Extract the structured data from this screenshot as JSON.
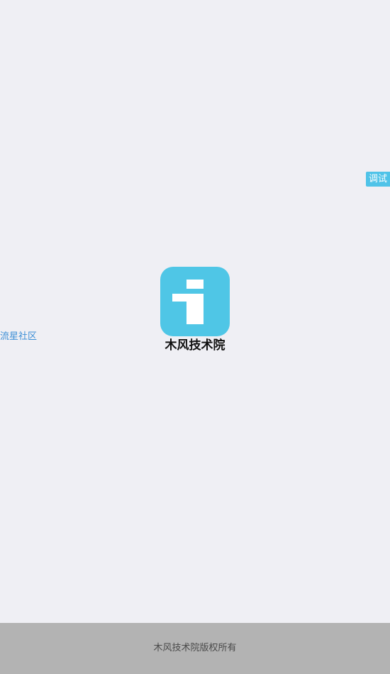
{
  "debug_badge": {
    "label": "调试"
  },
  "side_link": {
    "label": "流星社区"
  },
  "app": {
    "name": "木风技术院",
    "logo_color": "#4fc6e6",
    "logo_icon": "info-i-icon"
  },
  "footer": {
    "copyright": "木风技术院版权所有"
  },
  "colors": {
    "background": "#efeff4",
    "accent": "#4fc3e8",
    "link": "#3d8fd6",
    "footer_bg": "#b3b3b3"
  }
}
